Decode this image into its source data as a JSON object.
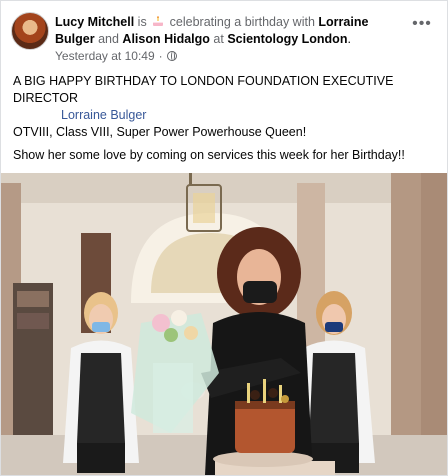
{
  "post": {
    "author": "Lucy Mitchell",
    "connector_is": "is",
    "activity": "celebrating a birthday with",
    "tagged_1": "Lorraine Bulger",
    "connector_and": "and",
    "tagged_2": "Alison Hidalgo",
    "connector_at": "at",
    "location": "Scientology London",
    "period": ".",
    "timestamp": "Yesterday at 10:49",
    "separator": "·",
    "more_label": "•••",
    "line_1": "A BIG HAPPY BIRTHDAY TO LONDON FOUNDATION EXECUTIVE DIRECTOR",
    "tag_link": "Lorraine Bulger",
    "line_2": "OTVIII, Class VIII, Super Power Powerhouse Queen!",
    "line_3": "Show her some love by coming on services this week for her Birthday!!"
  },
  "icons": {
    "privacy": "globe-icon",
    "activity": "cake-icon",
    "more": "more-options-icon"
  },
  "colors": {
    "link": "#385898",
    "muted": "#65676b",
    "text": "#050505"
  }
}
